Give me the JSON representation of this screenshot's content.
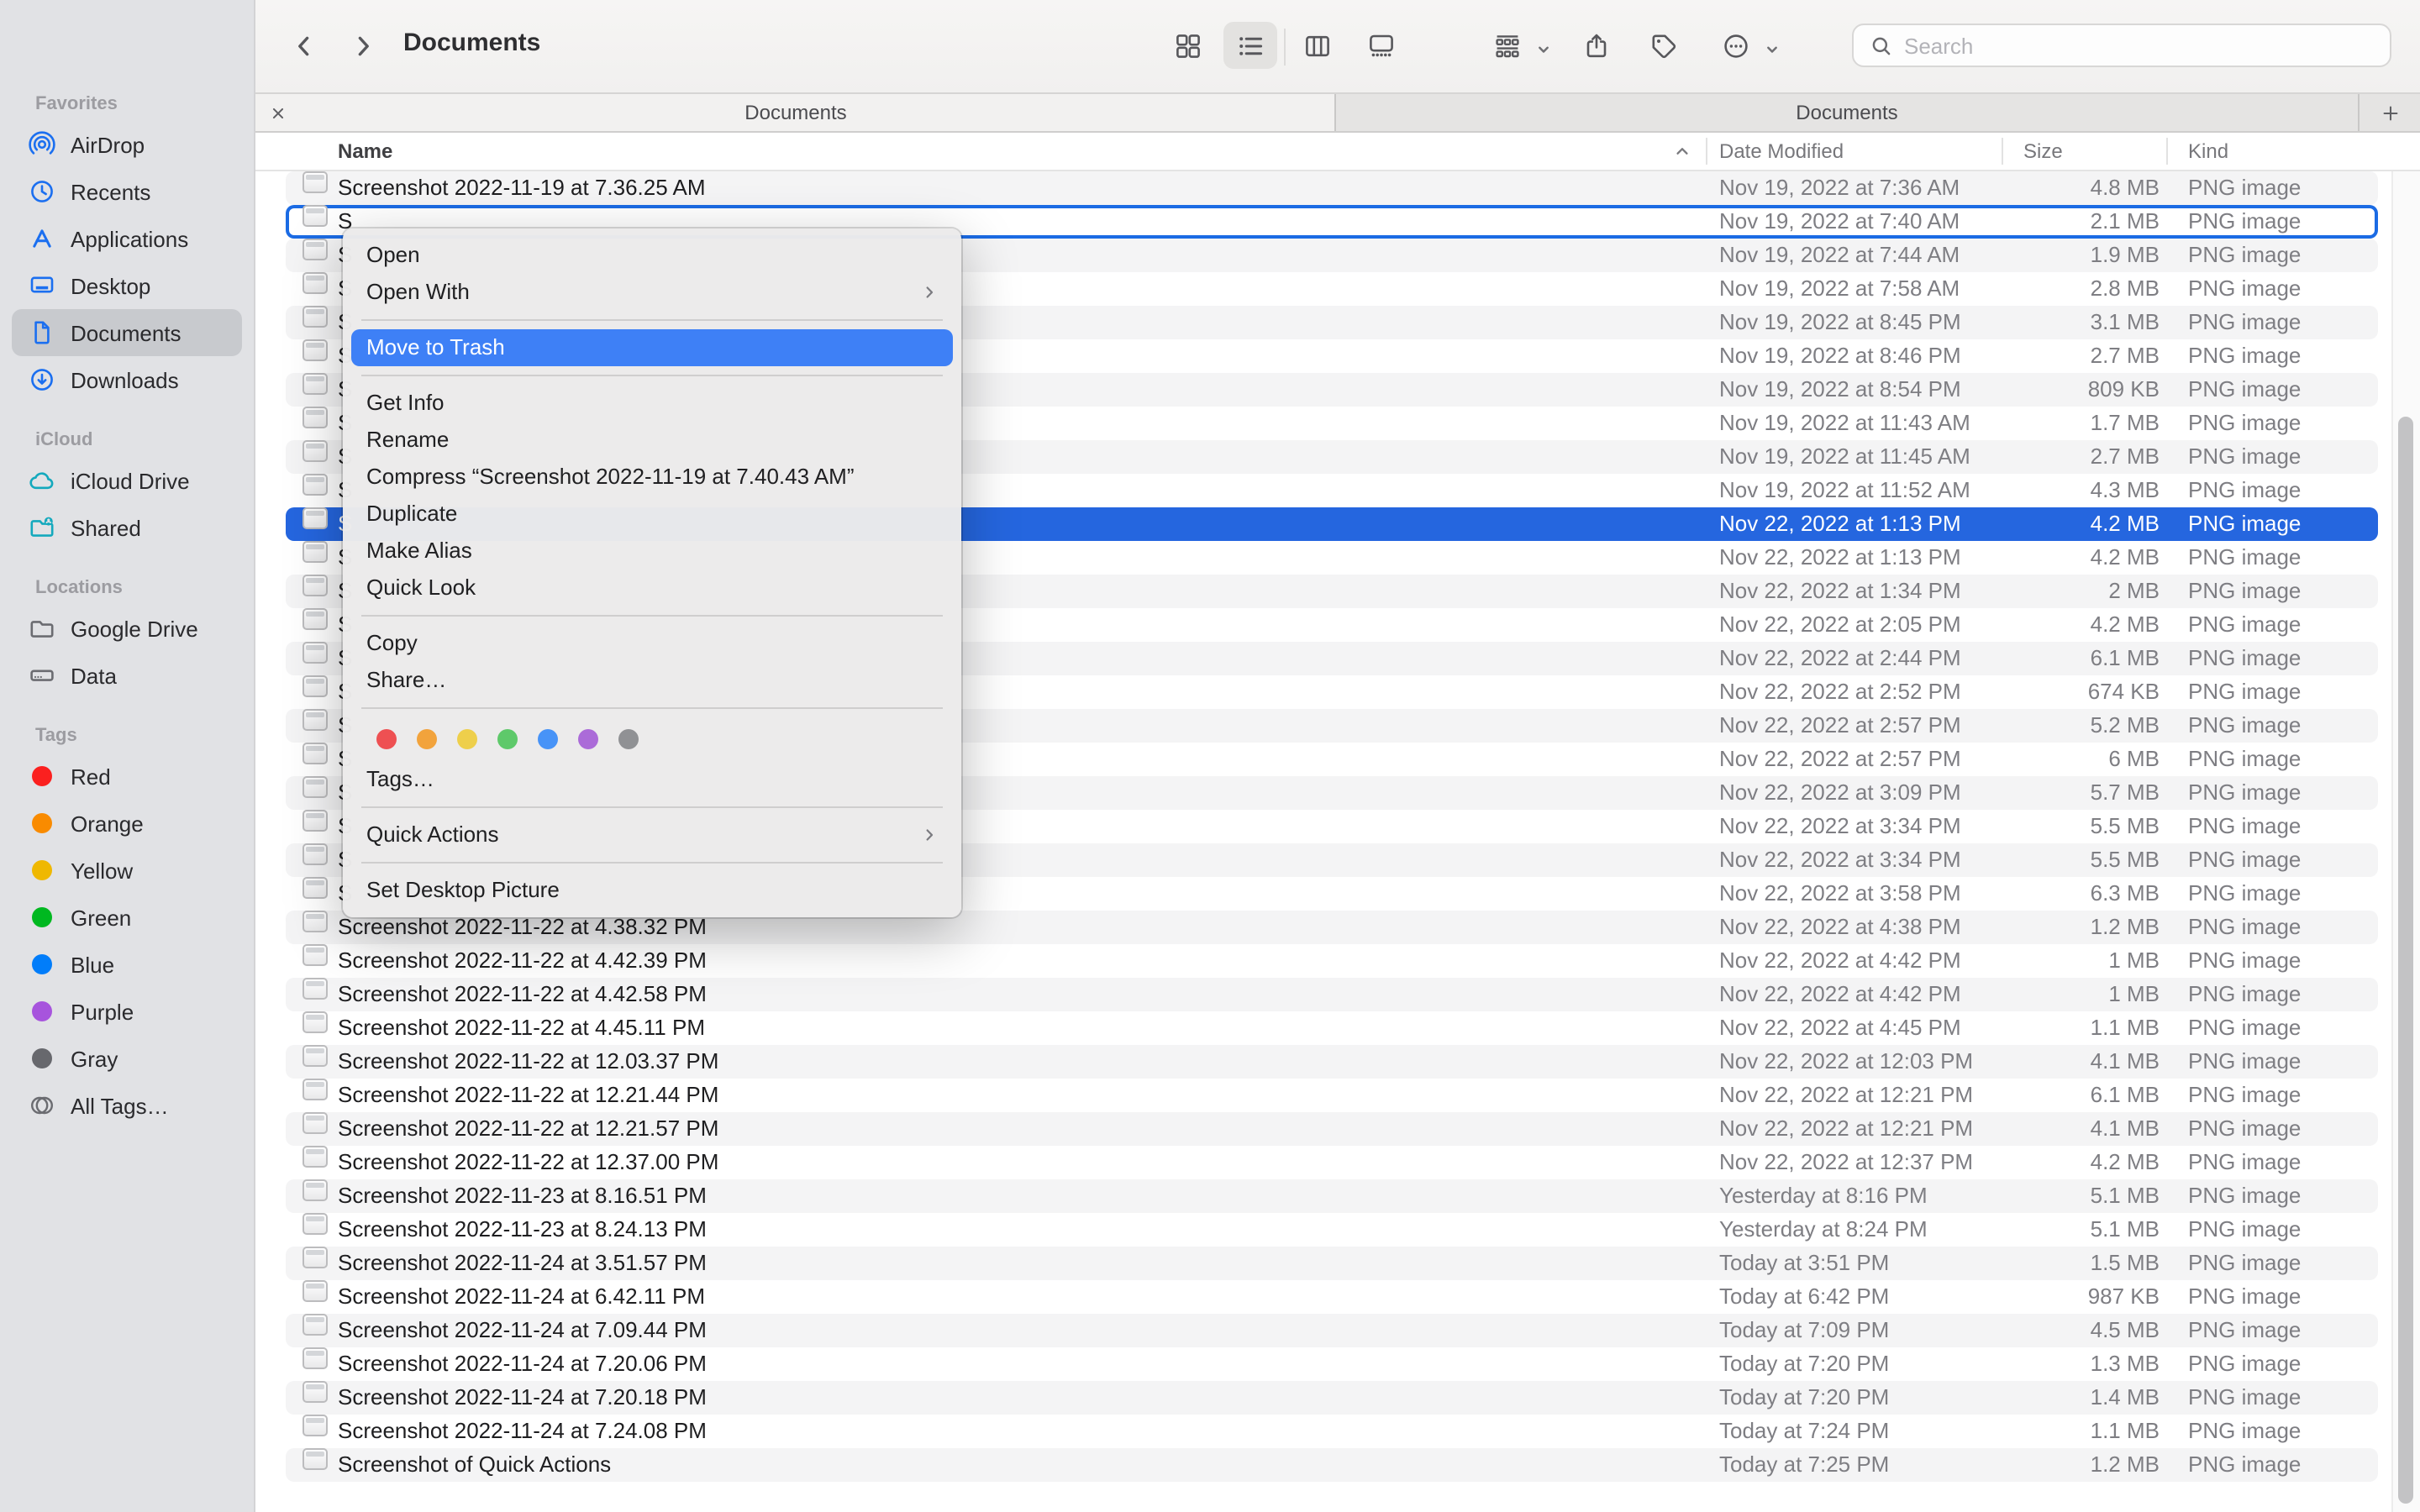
{
  "window": {
    "title": "Documents"
  },
  "toolbar": {
    "search_placeholder": "Search",
    "views": [
      "grid",
      "list",
      "columns",
      "gallery"
    ],
    "selected_view": "list",
    "actions": [
      "group-by",
      "share",
      "tags",
      "more-actions"
    ]
  },
  "tabs": {
    "items": [
      "Documents",
      "Documents"
    ],
    "active_index": 0
  },
  "columns": {
    "name": "Name",
    "date_modified": "Date Modified",
    "size": "Size",
    "kind": "Kind",
    "sorted_by": "Name",
    "sort_direction": "ascending"
  },
  "sidebar": {
    "sections": [
      {
        "title": "Favorites",
        "items": [
          {
            "label": "AirDrop",
            "icon": "airdrop-icon",
            "color": "#1b6ff0"
          },
          {
            "label": "Recents",
            "icon": "clock-icon",
            "color": "#1b6ff0"
          },
          {
            "label": "Applications",
            "icon": "appstore-icon",
            "color": "#1b6ff0"
          },
          {
            "label": "Desktop",
            "icon": "desktop-icon",
            "color": "#1b6ff0"
          },
          {
            "label": "Documents",
            "icon": "document-icon",
            "color": "#1b6ff0",
            "selected": true
          },
          {
            "label": "Downloads",
            "icon": "download-circle-icon",
            "color": "#1b6ff0"
          }
        ]
      },
      {
        "title": "iCloud",
        "items": [
          {
            "label": "iCloud Drive",
            "icon": "cloud-icon",
            "color": "#14a9bd"
          },
          {
            "label": "Shared",
            "icon": "shared-folder-icon",
            "color": "#14a9bd"
          }
        ]
      },
      {
        "title": "Locations",
        "items": [
          {
            "label": "Google Drive",
            "icon": "folder-icon",
            "color": "#6b6c71"
          },
          {
            "label": "Data",
            "icon": "hard-drive-icon",
            "color": "#6b6c71"
          }
        ]
      },
      {
        "title": "Tags",
        "items": [
          {
            "label": "Red",
            "icon": "tag-dot",
            "color": "#fb201f"
          },
          {
            "label": "Orange",
            "icon": "tag-dot",
            "color": "#f98b00"
          },
          {
            "label": "Yellow",
            "icon": "tag-dot",
            "color": "#efb800"
          },
          {
            "label": "Green",
            "icon": "tag-dot",
            "color": "#00b820"
          },
          {
            "label": "Blue",
            "icon": "tag-dot",
            "color": "#017dfa"
          },
          {
            "label": "Purple",
            "icon": "tag-dot",
            "color": "#a754dd"
          },
          {
            "label": "Gray",
            "icon": "tag-dot",
            "color": "#67686d"
          },
          {
            "label": "All Tags…",
            "icon": "all-tags-icon",
            "color": "#6b6c71"
          }
        ]
      }
    ]
  },
  "context_menu": {
    "highlight_color": "#3e80f6",
    "items": [
      {
        "type": "item",
        "label": "Open"
      },
      {
        "type": "item",
        "label": "Open With",
        "submenu": true
      },
      {
        "type": "sep"
      },
      {
        "type": "item",
        "label": "Move to Trash",
        "highlighted": true
      },
      {
        "type": "sep"
      },
      {
        "type": "item",
        "label": "Get Info"
      },
      {
        "type": "item",
        "label": "Rename"
      },
      {
        "type": "item",
        "label": "Compress “Screenshot 2022-11-19 at 7.40.43 AM”"
      },
      {
        "type": "item",
        "label": "Duplicate"
      },
      {
        "type": "item",
        "label": "Make Alias"
      },
      {
        "type": "item",
        "label": "Quick Look"
      },
      {
        "type": "sep"
      },
      {
        "type": "item",
        "label": "Copy"
      },
      {
        "type": "item",
        "label": "Share…"
      },
      {
        "type": "sep"
      },
      {
        "type": "tags"
      },
      {
        "type": "item",
        "label": "Tags…"
      },
      {
        "type": "sep"
      },
      {
        "type": "item",
        "label": "Quick Actions",
        "submenu": true
      },
      {
        "type": "sep"
      },
      {
        "type": "item",
        "label": "Set Desktop Picture"
      }
    ],
    "tag_colors": [
      {
        "name": "red",
        "hex": "#ee5052"
      },
      {
        "name": "orange",
        "hex": "#f2a33c"
      },
      {
        "name": "yellow",
        "hex": "#eecf4b"
      },
      {
        "name": "green",
        "hex": "#5ec96a"
      },
      {
        "name": "blue",
        "hex": "#4793f7"
      },
      {
        "name": "purple",
        "hex": "#ab6bd8"
      },
      {
        "name": "gray",
        "hex": "#909194"
      }
    ]
  },
  "file_list": {
    "stripe_color": "#f4f4f5",
    "selection_color": "#2566df",
    "focus_ring_color": "#1b6be4",
    "rows": [
      {
        "name": "Screenshot 2022-11-19 at 7.36.25 AM",
        "date": "Nov 19, 2022 at 7:36 AM",
        "size": "4.8 MB",
        "kind": "PNG image"
      },
      {
        "name": "S",
        "date": "Nov 19, 2022 at 7:40 AM",
        "size": "2.1 MB",
        "kind": "PNG image",
        "state": "focus"
      },
      {
        "name": "S",
        "date": "Nov 19, 2022 at 7:44 AM",
        "size": "1.9 MB",
        "kind": "PNG image"
      },
      {
        "name": "S",
        "date": "Nov 19, 2022 at 7:58 AM",
        "size": "2.8 MB",
        "kind": "PNG image"
      },
      {
        "name": "S",
        "date": "Nov 19, 2022 at 8:45 PM",
        "size": "3.1 MB",
        "kind": "PNG image"
      },
      {
        "name": "S",
        "date": "Nov 19, 2022 at 8:46 PM",
        "size": "2.7 MB",
        "kind": "PNG image"
      },
      {
        "name": "S",
        "date": "Nov 19, 2022 at 8:54 PM",
        "size": "809 KB",
        "kind": "PNG image"
      },
      {
        "name": "S",
        "date": "Nov 19, 2022 at 11:43 AM",
        "size": "1.7 MB",
        "kind": "PNG image"
      },
      {
        "name": "S",
        "date": "Nov 19, 2022 at 11:45 AM",
        "size": "2.7 MB",
        "kind": "PNG image"
      },
      {
        "name": "S",
        "date": "Nov 19, 2022 at 11:52 AM",
        "size": "4.3 MB",
        "kind": "PNG image"
      },
      {
        "name": "S",
        "date": "Nov 22, 2022 at 1:13 PM",
        "size": "4.2 MB",
        "kind": "PNG image",
        "state": "selected"
      },
      {
        "name": "S",
        "date": "Nov 22, 2022 at 1:13 PM",
        "size": "4.2 MB",
        "kind": "PNG image"
      },
      {
        "name": "S",
        "date": "Nov 22, 2022 at 1:34 PM",
        "size": "2 MB",
        "kind": "PNG image"
      },
      {
        "name": "S",
        "date": "Nov 22, 2022 at 2:05 PM",
        "size": "4.2 MB",
        "kind": "PNG image"
      },
      {
        "name": "S",
        "date": "Nov 22, 2022 at 2:44 PM",
        "size": "6.1 MB",
        "kind": "PNG image"
      },
      {
        "name": "S",
        "date": "Nov 22, 2022 at 2:52 PM",
        "size": "674 KB",
        "kind": "PNG image"
      },
      {
        "name": "S",
        "date": "Nov 22, 2022 at 2:57 PM",
        "size": "5.2 MB",
        "kind": "PNG image"
      },
      {
        "name": "S",
        "date": "Nov 22, 2022 at 2:57 PM",
        "size": "6 MB",
        "kind": "PNG image"
      },
      {
        "name": "S",
        "date": "Nov 22, 2022 at 3:09 PM",
        "size": "5.7 MB",
        "kind": "PNG image"
      },
      {
        "name": "S",
        "date": "Nov 22, 2022 at 3:34 PM",
        "size": "5.5 MB",
        "kind": "PNG image"
      },
      {
        "name": "S",
        "date": "Nov 22, 2022 at 3:34 PM",
        "size": "5.5 MB",
        "kind": "PNG image"
      },
      {
        "name": "S",
        "date": "Nov 22, 2022 at 3:58 PM",
        "size": "6.3 MB",
        "kind": "PNG image"
      },
      {
        "name": "Screenshot 2022-11-22 at 4.38.32 PM",
        "date": "Nov 22, 2022 at 4:38 PM",
        "size": "1.2 MB",
        "kind": "PNG image"
      },
      {
        "name": "Screenshot 2022-11-22 at 4.42.39 PM",
        "date": "Nov 22, 2022 at 4:42 PM",
        "size": "1 MB",
        "kind": "PNG image"
      },
      {
        "name": "Screenshot 2022-11-22 at 4.42.58 PM",
        "date": "Nov 22, 2022 at 4:42 PM",
        "size": "1 MB",
        "kind": "PNG image"
      },
      {
        "name": "Screenshot 2022-11-22 at 4.45.11 PM",
        "date": "Nov 22, 2022 at 4:45 PM",
        "size": "1.1 MB",
        "kind": "PNG image"
      },
      {
        "name": "Screenshot 2022-11-22 at 12.03.37 PM",
        "date": "Nov 22, 2022 at 12:03 PM",
        "size": "4.1 MB",
        "kind": "PNG image"
      },
      {
        "name": "Screenshot 2022-11-22 at 12.21.44 PM",
        "date": "Nov 22, 2022 at 12:21 PM",
        "size": "6.1 MB",
        "kind": "PNG image"
      },
      {
        "name": "Screenshot 2022-11-22 at 12.21.57 PM",
        "date": "Nov 22, 2022 at 12:21 PM",
        "size": "4.1 MB",
        "kind": "PNG image"
      },
      {
        "name": "Screenshot 2022-11-22 at 12.37.00 PM",
        "date": "Nov 22, 2022 at 12:37 PM",
        "size": "4.2 MB",
        "kind": "PNG image"
      },
      {
        "name": "Screenshot 2022-11-23 at 8.16.51 PM",
        "date": "Yesterday at 8:16 PM",
        "size": "5.1 MB",
        "kind": "PNG image"
      },
      {
        "name": "Screenshot 2022-11-23 at 8.24.13 PM",
        "date": "Yesterday at 8:24 PM",
        "size": "5.1 MB",
        "kind": "PNG image"
      },
      {
        "name": "Screenshot 2022-11-24 at 3.51.57 PM",
        "date": "Today at 3:51 PM",
        "size": "1.5 MB",
        "kind": "PNG image"
      },
      {
        "name": "Screenshot 2022-11-24 at 6.42.11 PM",
        "date": "Today at 6:42 PM",
        "size": "987 KB",
        "kind": "PNG image"
      },
      {
        "name": "Screenshot 2022-11-24 at 7.09.44 PM",
        "date": "Today at 7:09 PM",
        "size": "4.5 MB",
        "kind": "PNG image"
      },
      {
        "name": "Screenshot 2022-11-24 at 7.20.06 PM",
        "date": "Today at 7:20 PM",
        "size": "1.3 MB",
        "kind": "PNG image"
      },
      {
        "name": "Screenshot 2022-11-24 at 7.20.18 PM",
        "date": "Today at 7:20 PM",
        "size": "1.4 MB",
        "kind": "PNG image"
      },
      {
        "name": "Screenshot 2022-11-24 at 7.24.08 PM",
        "date": "Today at 7:24 PM",
        "size": "1.1 MB",
        "kind": "PNG image"
      },
      {
        "name": "Screenshot of Quick Actions",
        "date": "Today at 7:25 PM",
        "size": "1.2 MB",
        "kind": "PNG image"
      }
    ]
  }
}
